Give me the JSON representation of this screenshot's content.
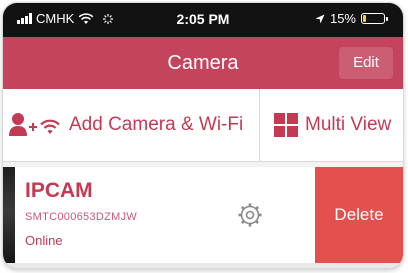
{
  "status_bar": {
    "carrier": "CMHK",
    "time": "2:05 PM",
    "battery_percent_label": "15%",
    "battery_level": 0.15,
    "icons": [
      "signal-icon",
      "wifi-icon",
      "activity-icon",
      "location-arrow-icon",
      "battery-icon"
    ]
  },
  "nav": {
    "title": "Camera",
    "edit_label": "Edit"
  },
  "toolbar": {
    "add_label": "Add Camera & Wi-Fi",
    "add_icon": "add-user-wifi-icon",
    "multi_label": "Multi View",
    "multi_icon": "grid-icon"
  },
  "cameras": [
    {
      "name": "IPCAM",
      "id": "SMTC000653DZMJW",
      "status": "Online",
      "settings_icon": "gear-icon",
      "delete_label": "Delete"
    }
  ],
  "colors": {
    "nav_background": "#c4445e",
    "accent": "#c33a52",
    "delete_background": "#e4504e",
    "status_bar_background": "#121212",
    "battery": "#f5d13a"
  }
}
